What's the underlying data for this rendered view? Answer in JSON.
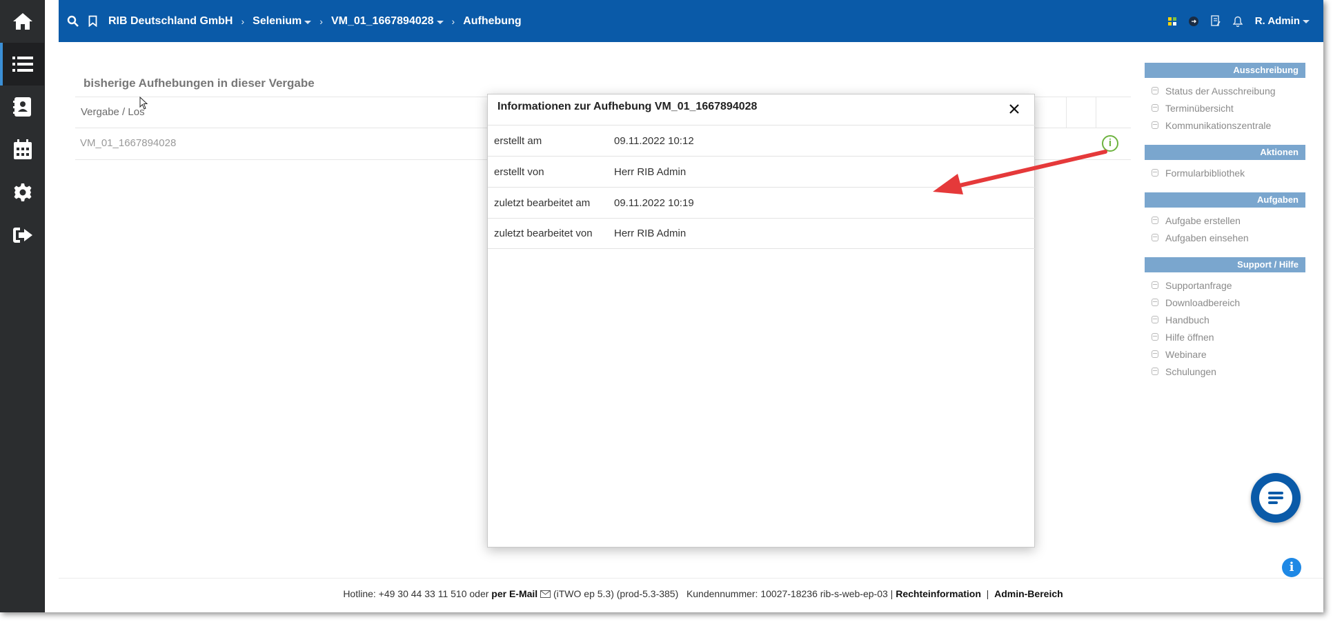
{
  "topbar": {
    "breadcrumb": [
      "RIB Deutschland GmbH",
      "Selenium",
      "VM_01_1667894028",
      "Aufhebung"
    ],
    "user": "R. Admin",
    "bg_color": "#0a5aa8"
  },
  "rail": {
    "items": [
      "home-icon",
      "list-icon",
      "contacts-icon",
      "calendar-icon",
      "settings-icon",
      "logout-icon"
    ],
    "active": "list-icon"
  },
  "main": {
    "section_title": "bisherige Aufhebungen in dieser Vergabe",
    "table": {
      "header": "Vergabe / Los",
      "rows": [
        {
          "vergabe": "VM_01_1667894028"
        }
      ]
    }
  },
  "modal": {
    "title": "Informationen zur Aufhebung VM_01_1667894028",
    "rows": [
      {
        "label": "erstellt am",
        "value": "09.11.2022 10:12"
      },
      {
        "label": "erstellt von",
        "value": "Herr RIB Admin"
      },
      {
        "label": "zuletzt bearbeitet am",
        "value": "09.11.2022 10:19"
      },
      {
        "label": "zuletzt bearbeitet von",
        "value": "Herr RIB Admin"
      }
    ]
  },
  "side": {
    "groups": [
      {
        "title": "Ausschreibung",
        "items": [
          "Status der Ausschreibung",
          "Terminübersicht",
          "Kommunikationszentrale"
        ]
      },
      {
        "title": "Aktionen",
        "items": [
          "Formularbibliothek"
        ]
      },
      {
        "title": "Aufgaben",
        "items": [
          "Aufgabe erstellen",
          "Aufgaben einsehen"
        ]
      },
      {
        "title": "Support / Hilfe",
        "items": [
          "Supportanfrage",
          "Downloadbereich",
          "Handbuch",
          "Hilfe öffnen",
          "Webinare",
          "Schulungen"
        ]
      }
    ]
  },
  "footer": {
    "hotline": "Hotline: +49 30 44 33 11 510 oder",
    "email": "per E-Mail",
    "version": "(iTWO ep 5.3) (prod-5.3-385)",
    "customer": "Kundennummer: 10027-18236 rib-s-web-ep-03 |",
    "legal": "Rechteinformation",
    "sep": "|",
    "admin": "Admin-Bereich"
  }
}
